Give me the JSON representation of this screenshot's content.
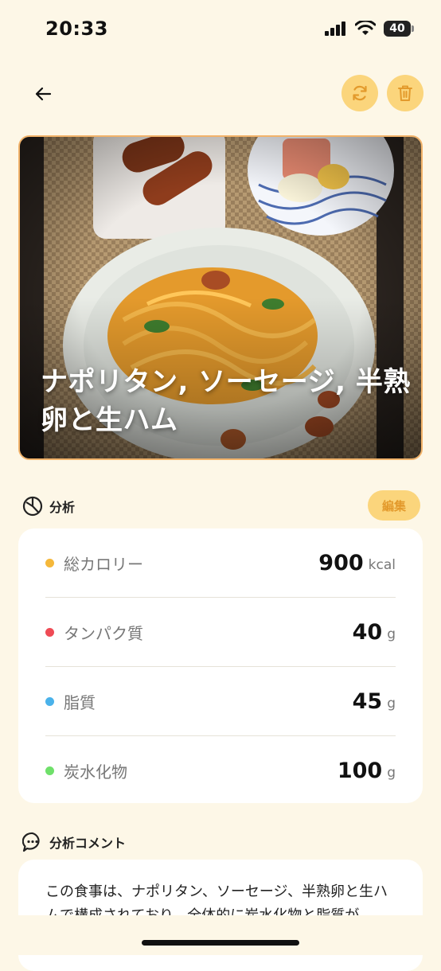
{
  "status_bar": {
    "time": "20:33",
    "battery": "40"
  },
  "nav": {
    "back_icon": "arrow-left-icon",
    "regenerate_icon": "refresh-icon",
    "delete_icon": "trash-icon"
  },
  "meal": {
    "title": "ナポリタン, ソーセージ, 半熟卵と生ハム"
  },
  "analysis": {
    "section_label": "分析",
    "edit_label": "編集",
    "items": [
      {
        "name": "総カロリー",
        "value": "900",
        "unit": "kcal",
        "color": "#f5b83a"
      },
      {
        "name": "タンパク質",
        "value": "40",
        "unit": "g",
        "color": "#ef4b55"
      },
      {
        "name": "脂質",
        "value": "45",
        "unit": "g",
        "color": "#4ab2ea"
      },
      {
        "name": "炭水化物",
        "value": "100",
        "unit": "g",
        "color": "#6fe06a"
      }
    ]
  },
  "comment": {
    "section_label": "分析コメント",
    "text": "この食事は、ナポリタン、ソーセージ、半熟卵と生ハムで構成されており、全体的に炭水化物と脂質が"
  },
  "colors": {
    "background": "#fdf7e7",
    "accent": "#fbd57c",
    "accent_text": "#e39a2c"
  }
}
